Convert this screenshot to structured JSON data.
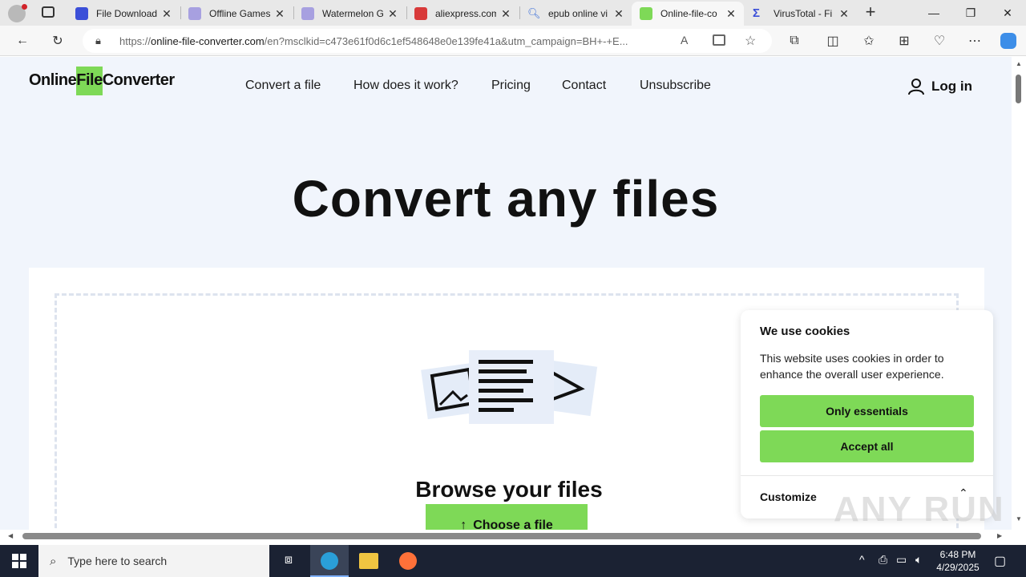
{
  "browser": {
    "tabs": [
      {
        "title": "File Download",
        "color": "#3b4fd8"
      },
      {
        "title": "Offline Games",
        "color": "#a7a0e0"
      },
      {
        "title": "Watermelon G",
        "color": "#a7a0e0"
      },
      {
        "title": "aliexpress.com",
        "color": "#d83a3a"
      },
      {
        "title": "epub online vi",
        "color": "#3b6fd8"
      },
      {
        "title": "Online-file-co",
        "color": "#7ed957",
        "active": true
      },
      {
        "title": "VirusTotal - Fi",
        "color": "#3b4fd8"
      }
    ],
    "address": {
      "prefix": "https://",
      "domain": "online-file-converter.com",
      "rest": "/en?msclkid=c473e61f0d6c1ef548648e0e139fe41a&utm_campaign=BH+-+E..."
    }
  },
  "site": {
    "logo": {
      "part1": "Online",
      "part2": "File",
      "part3": "Converter"
    },
    "nav": [
      "Convert a file",
      "How does it work?",
      "Pricing",
      "Contact",
      "Unsubscribe"
    ],
    "login": "Log in",
    "hero": "Convert any files",
    "browse": "Browse your files",
    "choose": "Choose a file"
  },
  "cookie": {
    "title": "We use cookies",
    "text": "This website uses cookies in order to enhance the overall user experience.",
    "essentials": "Only essentials",
    "accept": "Accept all",
    "customize": "Customize"
  },
  "watermark": "ANY RUN",
  "taskbar": {
    "search_placeholder": "Type here to search",
    "time": "6:48 PM",
    "date": "4/29/2025"
  },
  "colors": {
    "accent": "#7ed957",
    "page_bg": "#f1f5fc"
  }
}
